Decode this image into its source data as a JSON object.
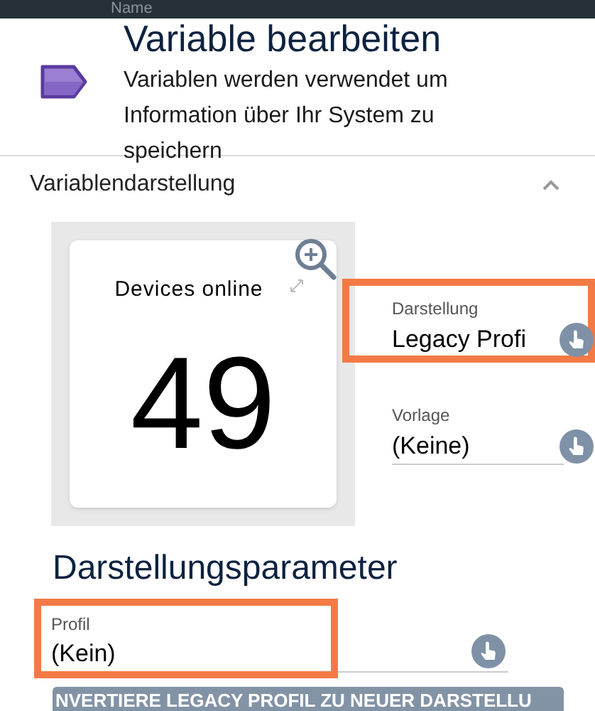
{
  "top_bar": {
    "label": "Name"
  },
  "header": {
    "title": "Variable bearbeiten",
    "description": "Variablen werden verwendet um Information über Ihr System zu speichern"
  },
  "section": {
    "title": "Variablendarstellung",
    "expanded": true
  },
  "preview": {
    "title": "Devices online",
    "value": "49"
  },
  "fields": [
    {
      "label": "Darstellung",
      "value": "Legacy Profi",
      "highlighted": true
    },
    {
      "label": "Vorlage",
      "value": "(Keine)",
      "highlighted": false
    }
  ],
  "parameters": {
    "title": "Darstellungsparameter",
    "field": {
      "label": "Profil",
      "value": "(Kein)",
      "highlighted": true
    }
  },
  "convert_button": {
    "label": "NVERTIERE LEGACY PROFIL ZU NEUER DARSTELLU"
  }
}
